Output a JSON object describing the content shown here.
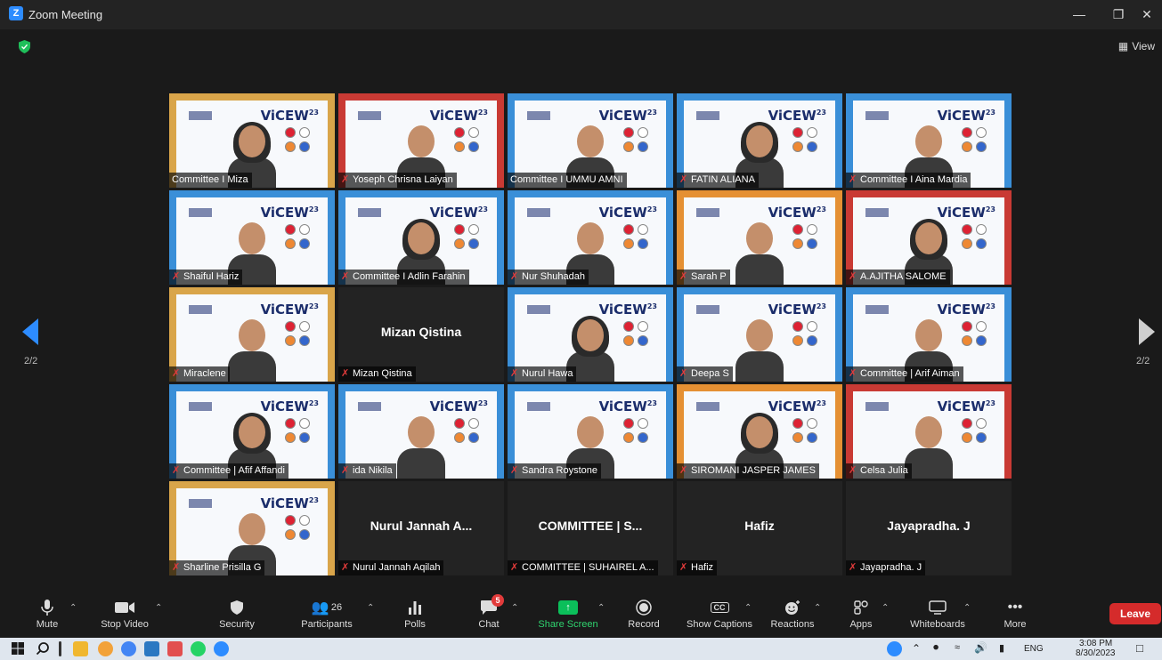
{
  "window": {
    "title": "Zoom Meeting",
    "logo": "Z"
  },
  "meeting": {
    "view_label": "View",
    "page_left": "2/2",
    "page_right": "2/2",
    "banner_brand": "ViCEW",
    "banner_year": "2023",
    "tiles": [
      {
        "name": "Committee I Miza",
        "type": "video",
        "muted": false,
        "active": true
      },
      {
        "name": "Yoseph Chrisna Laiyan",
        "type": "video",
        "muted": true
      },
      {
        "name": "Committee I UMMU AMNI",
        "type": "video",
        "muted": false
      },
      {
        "name": "FATIN ALIANA",
        "type": "video",
        "muted": true
      },
      {
        "name": "Committee I Aina Mardia",
        "type": "video",
        "muted": true
      },
      {
        "name": "Shaiful Hariz",
        "type": "video",
        "muted": true
      },
      {
        "name": "Committee I Adlin Farahin",
        "type": "video",
        "muted": true
      },
      {
        "name": "Nur Shuhadah",
        "type": "video",
        "muted": true
      },
      {
        "name": "Sarah P",
        "type": "video",
        "muted": true
      },
      {
        "name": "A.AJITHA SALOME",
        "type": "video",
        "muted": true
      },
      {
        "name": "Miraclene",
        "type": "video",
        "muted": true
      },
      {
        "name": "Mizan Qistina",
        "display": "Mizan Qistina",
        "type": "name",
        "muted": true
      },
      {
        "name": "Nurul Hawa",
        "type": "video",
        "muted": true
      },
      {
        "name": "Deepa S",
        "type": "video",
        "muted": true
      },
      {
        "name": "Committee | Arif Aiman",
        "type": "video",
        "muted": true
      },
      {
        "name": "Committee | Afif Affandi",
        "type": "video",
        "muted": true
      },
      {
        "name": "ida Nikila",
        "type": "video",
        "muted": true
      },
      {
        "name": "Sandra Roystone",
        "type": "video",
        "muted": true
      },
      {
        "name": "SIROMANI JASPER JAMES",
        "type": "video",
        "muted": true
      },
      {
        "name": "Celsa Julia",
        "type": "video",
        "muted": true
      },
      {
        "name": "Sharline Prisilla G",
        "type": "video",
        "muted": true
      },
      {
        "name": "Nurul Jannah Aqilah",
        "display": "Nurul Jannah A...",
        "type": "name",
        "muted": true
      },
      {
        "name": "COMMITTEE | SUHAIREL A...",
        "display": "COMMITTEE | S...",
        "type": "name",
        "muted": true
      },
      {
        "name": "Hafiz",
        "display": "Hafiz",
        "type": "name",
        "muted": true
      },
      {
        "name": "Jayapradha. J",
        "display": "Jayapradha. J",
        "type": "name",
        "muted": true
      }
    ]
  },
  "toolbar": {
    "mute": "Mute",
    "stop_video": "Stop Video",
    "security": "Security",
    "participants": "Participants",
    "participants_count": "26",
    "polls": "Polls",
    "chat": "Chat",
    "chat_badge": "5",
    "share_screen": "Share Screen",
    "record": "Record",
    "show_captions": "Show Captions",
    "captions_icon": "CC",
    "reactions": "Reactions",
    "apps": "Apps",
    "whiteboards": "Whiteboards",
    "more": "More",
    "leave": "Leave"
  },
  "taskbar": {
    "lang": "ENG",
    "time": "3:08 PM",
    "date": "8/30/2023"
  },
  "colors": {
    "accent": "#2d8cff",
    "share_green": "#0bbf5a",
    "leave_red": "#d52b2b",
    "active_speaker": "#e9e98a",
    "muted_red": "#e23b3b"
  }
}
